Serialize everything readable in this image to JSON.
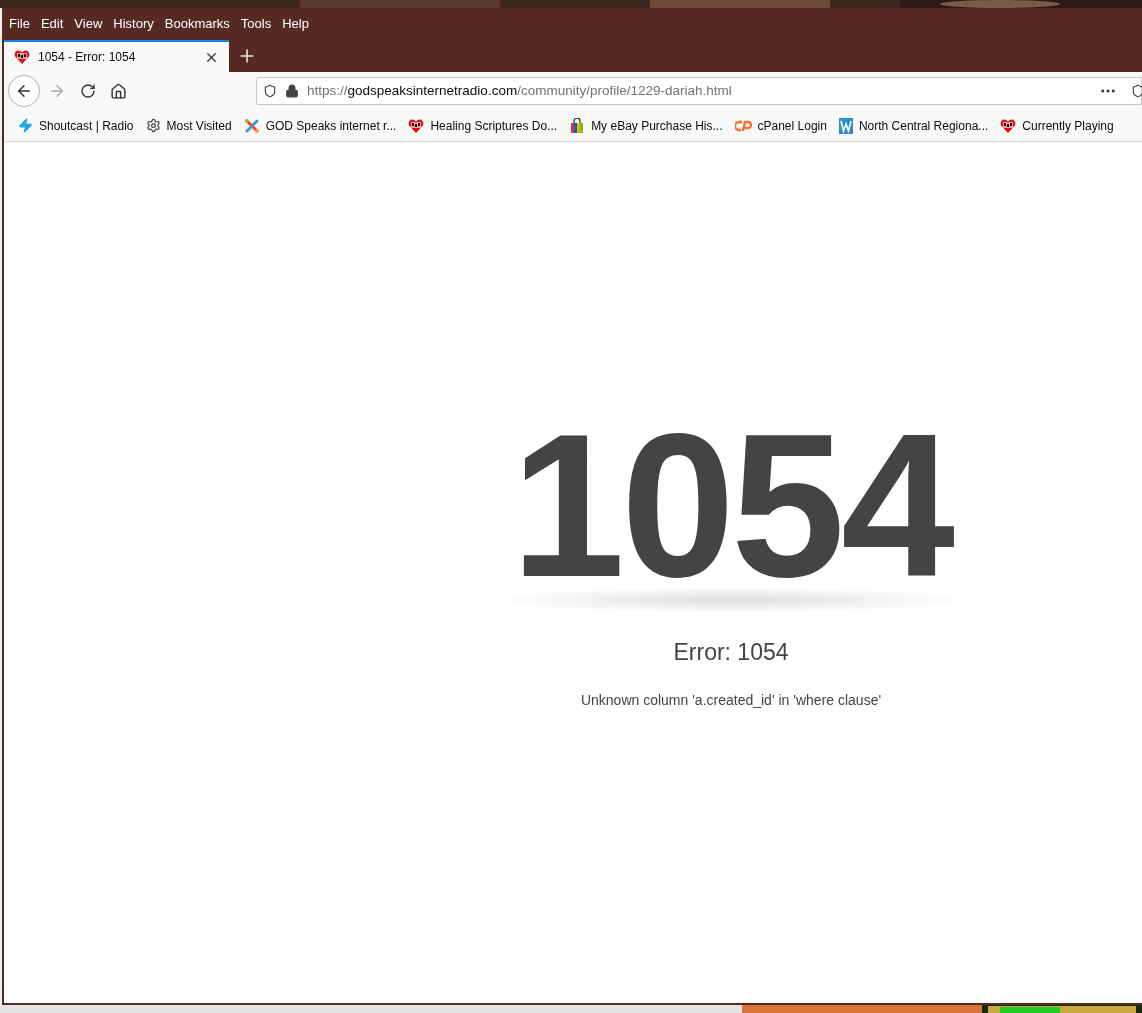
{
  "menu_bar": {
    "items": [
      "File",
      "Edit",
      "View",
      "History",
      "Bookmarks",
      "Tools",
      "Help"
    ]
  },
  "tabs": [
    {
      "title": "1054 - Error: 1054",
      "selected": true
    }
  ],
  "address_bar": {
    "scheme": "https://",
    "host": "godspeaksinternetradio.com",
    "path": "/community/profile/1229-dariah.html"
  },
  "bookmarks": [
    "Shoutcast | Radio",
    "Most Visited",
    "GOD Speaks internet r...",
    "Healing Scriptures Do...",
    "My eBay Purchase His...",
    "cPanel Login",
    "North Central Regiona...",
    "Currently Playing"
  ],
  "page": {
    "code": "1054",
    "title": "Error: 1054",
    "message": "Unknown column 'a.created_id' in 'where clause'"
  }
}
